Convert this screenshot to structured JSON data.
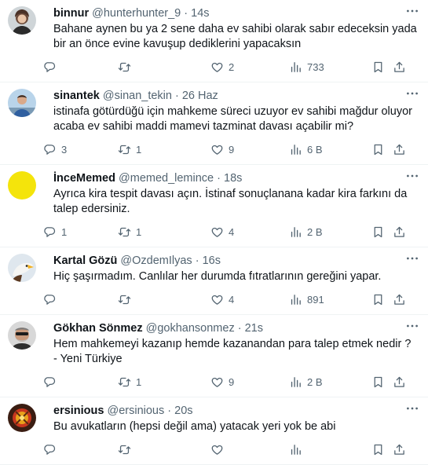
{
  "tweets": [
    {
      "name": "binnur",
      "handle": "@hunterhunter_9",
      "time": "14s",
      "text": "Bahane aynen bu ya 2 sene daha ev sahibi olarak sabır edeceksin yada bir an önce evine kavuşup dediklerini yapacaksın",
      "replies": "",
      "retweets": "",
      "likes": "2",
      "views": "733"
    },
    {
      "name": "sinantek",
      "handle": "@sinan_tekin",
      "time": "26 Haz",
      "text": "istinafa götürdüğü için mahkeme süreci uzuyor ev sahibi mağdur oluyor acaba ev sahibi maddi mamevi tazminat davası açabilir mi?",
      "replies": "3",
      "retweets": "1",
      "likes": "9",
      "views": "6 B"
    },
    {
      "name": "İnceMemed",
      "handle": "@memed_lemince",
      "time": "18s",
      "text": "Ayrıca kira tespit davası açın. İstinaf sonuçlanana kadar kira farkını da talep edersiniz.",
      "replies": "1",
      "retweets": "1",
      "likes": "4",
      "views": "2 B"
    },
    {
      "name": "Kartal Gözü",
      "handle": "@OzdemIlyas",
      "time": "16s",
      "text": "Hiç şaşırmadım. Canlılar her durumda fıtratlarının gereğini yapar.",
      "replies": "",
      "retweets": "",
      "likes": "4",
      "views": "891"
    },
    {
      "name": "Gökhan Sönmez",
      "handle": "@gokhansonmez",
      "time": "21s",
      "text": "Hem mahkemeyi kazanıp hemde kazanandan para talep etmek nedir ?\n- Yeni Türkiye",
      "replies": "",
      "retweets": "1",
      "likes": "9",
      "views": "2 B"
    },
    {
      "name": "ersinious",
      "handle": "@ersinious",
      "time": "20s",
      "text": "Bu avukatların (hepsi değil ama) yatacak yeri yok be abi",
      "replies": "",
      "retweets": "",
      "likes": "",
      "views": ""
    }
  ],
  "dot": "·",
  "icons": {
    "reply": "reply-icon",
    "retweet": "retweet-icon",
    "like": "heart-icon",
    "views": "views-chart-icon",
    "bookmark": "bookmark-icon",
    "share": "share-icon",
    "more": "more-dots-icon"
  }
}
